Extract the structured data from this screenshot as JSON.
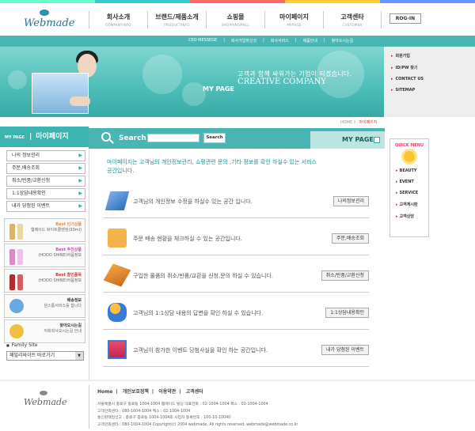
{
  "logo": {
    "text": "Webmade"
  },
  "gnb": [
    {
      "ko": "회사소개",
      "en": "COMPANYINFO"
    },
    {
      "ko": "브랜드/제품소개",
      "en": "PRODUCTINFO"
    },
    {
      "ko": "쇼핑몰",
      "en": "SHOPPINGMALL"
    },
    {
      "ko": "마이페이지",
      "en": "MYPAGE"
    },
    {
      "ko": "고객센타",
      "en": "CUSTOMER"
    }
  ],
  "login": "ROG-IN",
  "subnav": [
    "CEO MESSEGE",
    "회사가입하신것",
    "회사서비스",
    "제품안내",
    "찾아오시는길"
  ],
  "banner": {
    "ko": "고객과 함께 싸워가는 기업이 되겠습니다.",
    "en": "CREATIVE COMPANY",
    "mypage": "MY PAGE"
  },
  "rightlinks": [
    "회원가입",
    "ID/PW 찾기",
    "CONTACT US",
    "SITEMAP"
  ],
  "crumbs": {
    "home": "HOME",
    "sep": "》",
    "current": "마이페이지"
  },
  "left": {
    "small": "MY PAGE",
    "title": "마이페이지",
    "menu": [
      "나의 정보관리",
      "주문,배송조회",
      "취소/반품/교환신청",
      "1:1상담내용확인",
      "내가 당첨된 이벤트"
    ]
  },
  "products": [
    {
      "title": "Best 인기상품",
      "l1": "웹메이드 화이트클렌징(30ml)",
      "l2": ""
    },
    {
      "title": "Best 추천상품",
      "l1": "(HODO SHINE)비품정보",
      "l2": ""
    },
    {
      "title": "Best 할인품목",
      "l1": "(HODO SHINE)비품정보",
      "l2": ""
    },
    {
      "title": "배송정보",
      "l1": "원스톱서비스를 합니다",
      "l2": ""
    },
    {
      "title": "찾아오시는길",
      "l1": "저희회사오시는길 안내",
      "l2": ""
    }
  ],
  "family": {
    "label": "Family Site",
    "select": "패밀리싸이트 바로가기"
  },
  "search": {
    "label": "Search",
    "button": "Search"
  },
  "mypage_tag": "MY PAGE",
  "intro": "마이페이지는  고객님의 개인정보관리, 쇼핑관련 문의 ,기타 정보를 확인 하실수 있는 서비스 공간입니다.",
  "rows": [
    {
      "text": "고객님의 개인정보 수정을 하실수 있는 공간 입니다.",
      "btn": "나의정보관리"
    },
    {
      "text": "주문 배송 현황을 체크하실 수 있는 공간입니다.",
      "btn": "주문,배송조회"
    },
    {
      "text": "구입한 물품의 취소/반품/교환을 신청,문의 하실 수 있습니다.",
      "btn": "취소/반품/교환신청"
    },
    {
      "text": "고객님의 1:1상담 내용의 답변을 확인 하실 수 있습니다.",
      "btn": "1:1상담내용확인"
    },
    {
      "text": "고객님이 참가한 이벤트 당첨사실을 확인 하는 공간입니다.",
      "btn": "내가 당첨된 이벤트"
    }
  ],
  "quick": {
    "title": "QUICK MENU",
    "items": [
      "BEAUTY",
      "EVENT",
      "SERVICE",
      "고객게시판",
      "고객상담"
    ]
  },
  "footer": {
    "logo": "Webmade",
    "links": [
      "Home",
      "개인보호정책",
      "이용약관",
      "고객센터"
    ],
    "lines": [
      "서울특별시 종로구 종로동 1004-1004 웹메이드 빌딩   대표전화 : 02-1004-1004   팩스 : 02-1004-1004",
      "고객만족센타 : 080-1004-1004   팩스 : 02-1004-1004",
      "통신판매업신고 : 종로구 종로동 1004-1004호  사업자 등록번호 : 100-10-10040",
      "고객만족센타 : 080-1004-1004   Copyright(c) 2004 webmade, All rights reserved. webmade@webmade.co.kr"
    ]
  }
}
